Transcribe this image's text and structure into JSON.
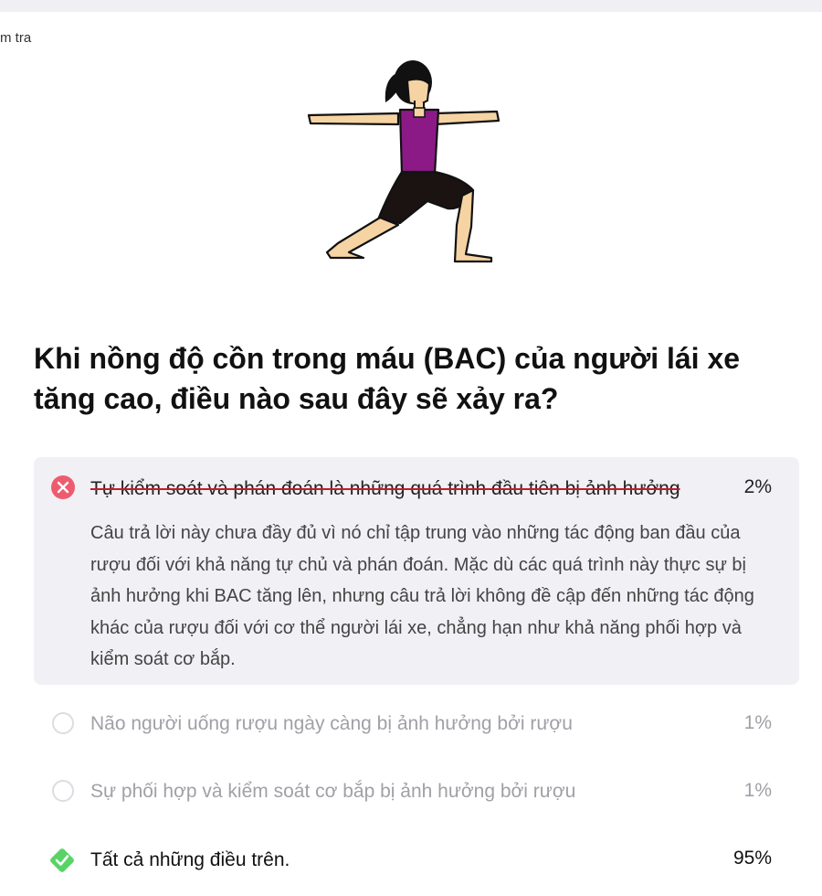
{
  "breadcrumb": "m tra",
  "question": "Khi nồng độ cồn trong máu (BAC) của người lái xe tăng cao, điều nào sau đây sẽ xảy ra?",
  "options": [
    {
      "text": "Tự kiểm soát và phán đoán là những quá trình đầu tiên bị ảnh hưởng",
      "percent": "2%",
      "state": "incorrect-selected",
      "icon": "x-circle-icon",
      "explanation": "Câu trả lời này chưa đầy đủ vì nó chỉ tập trung vào những tác động ban đầu của rượu đối với khả năng tự chủ và phán đoán. Mặc dù các quá trình này thực sự bị ảnh hưởng khi BAC tăng lên, nhưng câu trả lời không đề cập đến những tác động khác của rượu đối với cơ thể người lái xe, chẳng hạn như khả năng phối hợp và kiểm soát cơ bắp."
    },
    {
      "text": "Não người uống rượu ngày càng bị ảnh hưởng bởi rượu",
      "percent": "1%",
      "state": "unselected",
      "icon": "radio-icon"
    },
    {
      "text": "Sự phối hợp và kiểm soát cơ bắp bị ảnh hưởng bởi rượu",
      "percent": "1%",
      "state": "unselected",
      "icon": "radio-icon"
    },
    {
      "text": "Tất cả những điều trên.",
      "percent": "95%",
      "state": "correct",
      "icon": "check-diamond-icon"
    }
  ],
  "colors": {
    "incorrect": "#ee5b6f",
    "correct": "#58d466",
    "selected_bg": "#f1f0f5",
    "strike": "#c21d2c"
  }
}
